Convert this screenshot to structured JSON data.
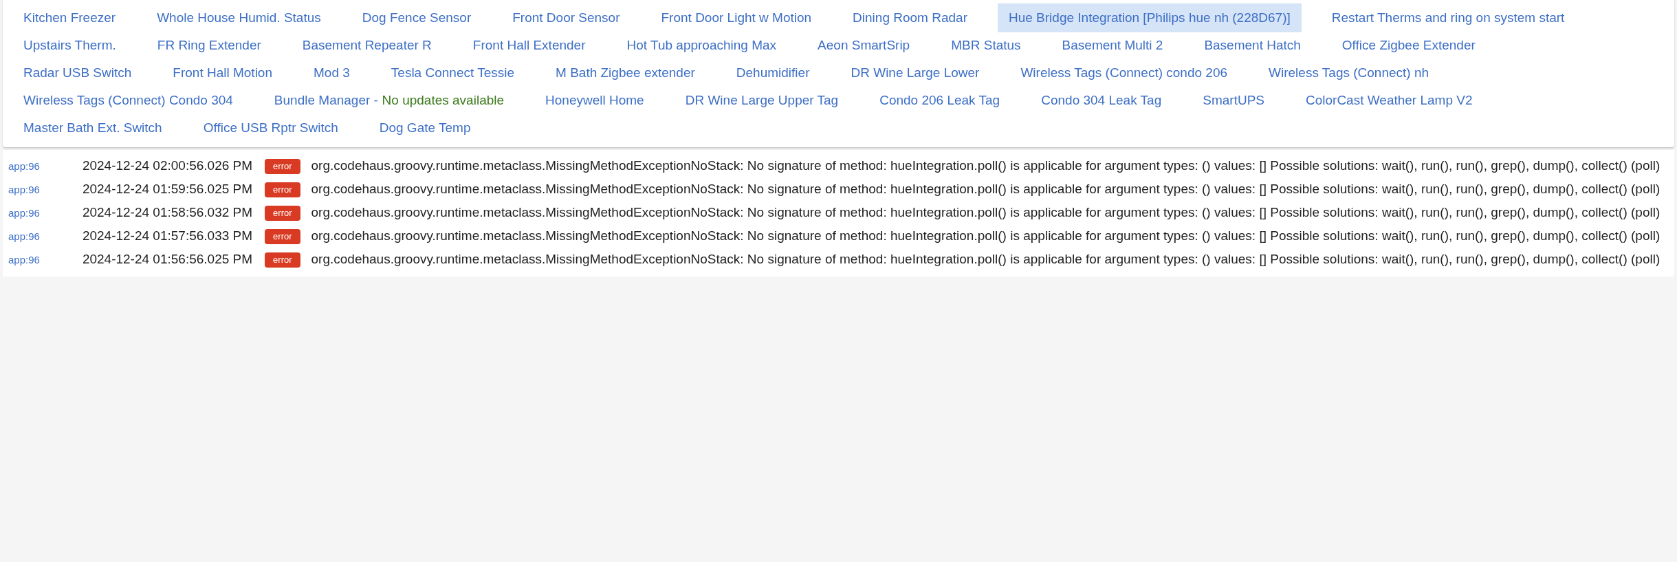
{
  "tab_rows": [
    [
      {
        "label": "Kitchen Freezer",
        "selected": false
      },
      {
        "label": "Whole House Humid. Status",
        "selected": false
      },
      {
        "label": "Dog Fence Sensor",
        "selected": false
      },
      {
        "label": "Front Door Sensor",
        "selected": false
      },
      {
        "label": "Front Door Light w Motion",
        "selected": false
      },
      {
        "label": "Dining Room Radar",
        "selected": false
      },
      {
        "label": "Hue Bridge Integration [Philips hue nh (228D67)]",
        "selected": true
      },
      {
        "label": "Restart Therms and ring on system start",
        "selected": false
      }
    ],
    [
      {
        "label": "Upstairs Therm.",
        "selected": false
      },
      {
        "label": "FR Ring Extender",
        "selected": false
      },
      {
        "label": "Basement Repeater R",
        "selected": false
      },
      {
        "label": "Front Hall Extender",
        "selected": false
      },
      {
        "label": "Hot Tub approaching Max",
        "selected": false
      },
      {
        "label": "Aeon SmartSrip",
        "selected": false
      },
      {
        "label": "MBR Status",
        "selected": false
      },
      {
        "label": "Basement Multi 2",
        "selected": false
      },
      {
        "label": "Basement Hatch",
        "selected": false
      },
      {
        "label": "Office Zigbee Extender",
        "selected": false
      }
    ],
    [
      {
        "label": "Radar USB Switch",
        "selected": false
      },
      {
        "label": "Front Hall Motion",
        "selected": false
      },
      {
        "label": "Mod 3",
        "selected": false
      },
      {
        "label": "Tesla Connect Tessie",
        "selected": false
      },
      {
        "label": "M Bath Zigbee extender",
        "selected": false
      },
      {
        "label": "Dehumidifier",
        "selected": false
      },
      {
        "label": "DR Wine Large Lower",
        "selected": false
      },
      {
        "label": "Wireless Tags (Connect) condo 206",
        "selected": false
      },
      {
        "label": "Wireless Tags (Connect) nh",
        "selected": false
      }
    ],
    [
      {
        "label": "Wireless Tags (Connect) Condo 304",
        "selected": false
      },
      {
        "label": "Bundle Manager -",
        "status": "No updates available",
        "selected": false
      },
      {
        "label": "Honeywell Home",
        "selected": false
      },
      {
        "label": "DR Wine Large Upper Tag",
        "selected": false
      },
      {
        "label": "Condo 206 Leak Tag",
        "selected": false
      },
      {
        "label": "Condo 304 Leak Tag",
        "selected": false
      },
      {
        "label": "SmartUPS",
        "selected": false
      },
      {
        "label": "ColorCast Weather Lamp V2",
        "selected": false
      }
    ],
    [
      {
        "label": "Master Bath Ext. Switch",
        "selected": false
      },
      {
        "label": "Office USB Rptr Switch",
        "selected": false
      },
      {
        "label": "Dog Gate Temp",
        "selected": false
      }
    ]
  ],
  "log": [
    {
      "source": "app:96",
      "time": "2024-12-24 02:00:56.026 PM",
      "level": "error",
      "message": "org.codehaus.groovy.runtime.metaclass.MissingMethodExceptionNoStack: No signature of method: hueIntegration.poll() is applicable for argument types: () values: [] Possible solutions: wait(), run(), run(), grep(), dump(), collect() (poll)"
    },
    {
      "source": "app:96",
      "time": "2024-12-24 01:59:56.025 PM",
      "level": "error",
      "message": "org.codehaus.groovy.runtime.metaclass.MissingMethodExceptionNoStack: No signature of method: hueIntegration.poll() is applicable for argument types: () values: [] Possible solutions: wait(), run(), run(), grep(), dump(), collect() (poll)"
    },
    {
      "source": "app:96",
      "time": "2024-12-24 01:58:56.032 PM",
      "level": "error",
      "message": "org.codehaus.groovy.runtime.metaclass.MissingMethodExceptionNoStack: No signature of method: hueIntegration.poll() is applicable for argument types: () values: [] Possible solutions: wait(), run(), run(), grep(), dump(), collect() (poll)"
    },
    {
      "source": "app:96",
      "time": "2024-12-24 01:57:56.033 PM",
      "level": "error",
      "message": "org.codehaus.groovy.runtime.metaclass.MissingMethodExceptionNoStack: No signature of method: hueIntegration.poll() is applicable for argument types: () values: [] Possible solutions: wait(), run(), run(), grep(), dump(), collect() (poll)"
    },
    {
      "source": "app:96",
      "time": "2024-12-24 01:56:56.025 PM",
      "level": "error",
      "message": "org.codehaus.groovy.runtime.metaclass.MissingMethodExceptionNoStack: No signature of method: hueIntegration.poll() is applicable for argument types: () values: [] Possible solutions: wait(), run(), run(), grep(), dump(), collect() (poll)"
    }
  ]
}
